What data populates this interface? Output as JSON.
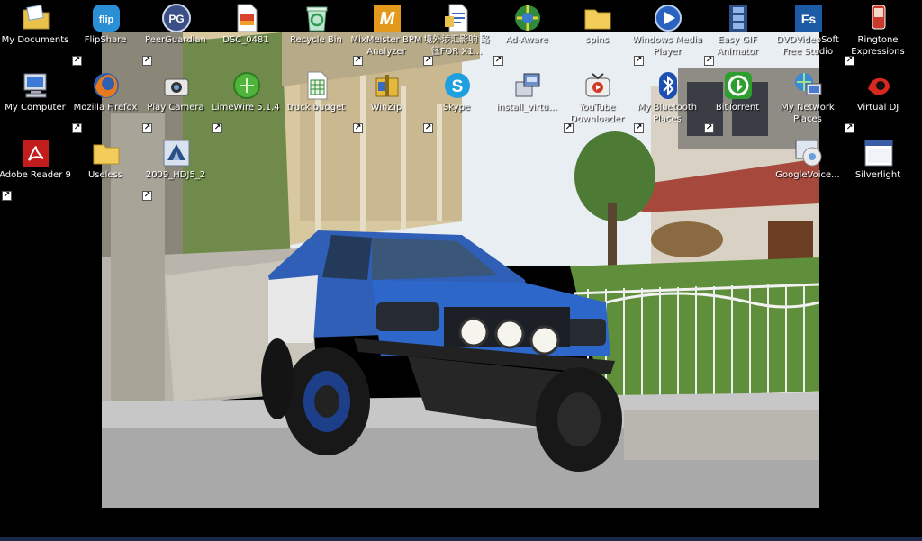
{
  "desktop": {
    "icons": [
      {
        "label": "My Documents",
        "icon": "my-documents-icon"
      },
      {
        "label": "FlipShare",
        "icon": "flipshare-icon"
      },
      {
        "label": "PeerGuardian",
        "icon": "peerguardian-icon"
      },
      {
        "label": "DSC_0481",
        "icon": "image-file-icon"
      },
      {
        "label": "Recycle Bin",
        "icon": "recycle-bin-icon"
      },
      {
        "label": "MixMeister BPM Analyzer",
        "icon": "mixmeister-icon"
      },
      {
        "label": "境外涉汇影响 路径FOR X1...",
        "icon": "document-icon"
      },
      {
        "label": "Ad-Aware",
        "icon": "ad-aware-icon"
      },
      {
        "label": "spins",
        "icon": "folder-icon"
      },
      {
        "label": "Windows Media Player",
        "icon": "windows-media-player-icon"
      },
      {
        "label": "Easy GIF Animator",
        "icon": "easy-gif-animator-icon"
      },
      {
        "label": "DVDVideoSoft Free Studio",
        "icon": "dvdvideosoft-icon"
      },
      {
        "label": "Ringtone Expressions",
        "icon": "ringtone-expressions-icon"
      },
      {
        "label": "My Computer",
        "icon": "my-computer-icon"
      },
      {
        "label": "Mozilla Firefox",
        "icon": "firefox-icon"
      },
      {
        "label": "Play Camera",
        "icon": "play-camera-icon"
      },
      {
        "label": "LimeWire 5.1.4",
        "icon": "limewire-icon"
      },
      {
        "label": "truck budget",
        "icon": "spreadsheet-icon"
      },
      {
        "label": "WinZip",
        "icon": "winzip-icon"
      },
      {
        "label": "Skype",
        "icon": "skype-icon"
      },
      {
        "label": "install_virtu...",
        "icon": "installer-icon"
      },
      {
        "label": "YouTube Downloader",
        "icon": "youtube-downloader-icon"
      },
      {
        "label": "My Bluetooth Places",
        "icon": "bluetooth-icon"
      },
      {
        "label": "BitTorrent",
        "icon": "bittorrent-icon"
      },
      {
        "label": "My Network Places",
        "icon": "network-places-icon"
      },
      {
        "label": "Virtual DJ",
        "icon": "virtual-dj-icon"
      },
      {
        "label": "Adobe Reader 9",
        "icon": "adobe-reader-icon"
      },
      {
        "label": "Useless",
        "icon": "folder-icon"
      },
      {
        "label": "2009_HDJ5_2",
        "icon": "media-file-icon"
      },
      {
        "label": "GoogleVoice...",
        "icon": "google-voice-icon"
      },
      {
        "label": "Silverlight",
        "icon": "silverlight-icon"
      }
    ]
  },
  "wallpaper": {
    "subject": "truck-photo"
  }
}
